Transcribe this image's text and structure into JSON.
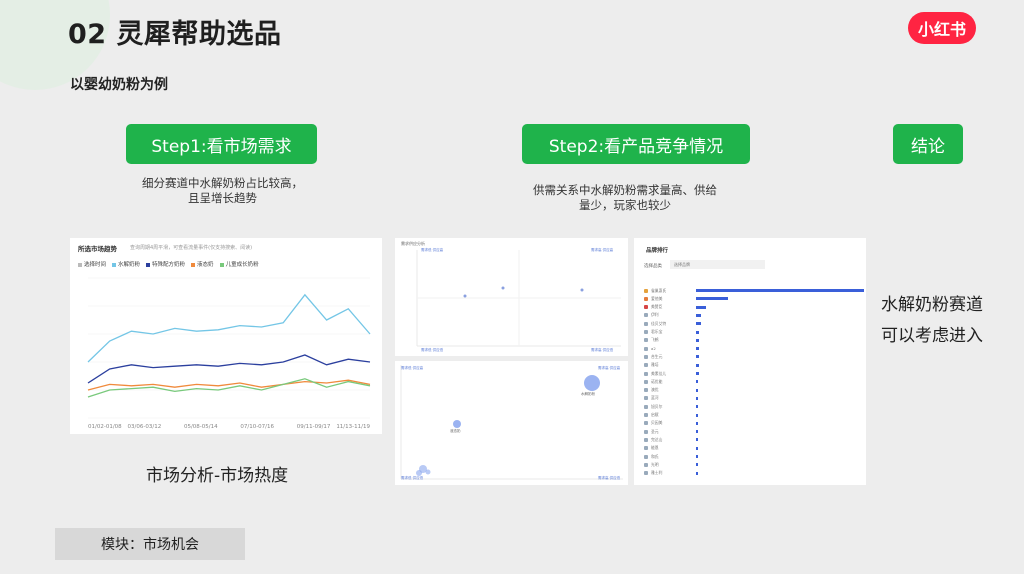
{
  "slide": {
    "title": "02 灵犀帮助选品",
    "logo": "小红书",
    "subtitle": "以婴幼奶粉为例",
    "caption": "市场分析-市场热度",
    "module_tag": "模块：市场机会"
  },
  "steps": [
    {
      "label": "Step1:看市场需求",
      "desc": "细分赛道中水解奶粉占比较高，且呈增长趋势"
    },
    {
      "label": "Step2:看产品竞争情况",
      "desc": "供需关系中水解奶粉需求量高、供给量少，玩家也较少"
    },
    {
      "label": "结论",
      "desc": "水解奶粉赛道可以考虑进入"
    }
  ],
  "chart_panel": {
    "title": "所选市场趋势",
    "note": "查询周期4周平滑，可查看流量事件(仅支持搜索、阅读)",
    "legend": [
      {
        "name": "选择时间",
        "color": "#bbbbbb"
      },
      {
        "name": "水解奶粉",
        "color": "#74c6e6"
      },
      {
        "name": "特殊配方奶粉",
        "color": "#2b3f9e"
      },
      {
        "name": "液态奶",
        "color": "#f08a3c"
      },
      {
        "name": "儿童成长奶粉",
        "color": "#79c97c"
      }
    ],
    "x_ticks": [
      "01/02-01/08",
      "03/06-03/12",
      "05/08-05/14",
      "07/10-07/16",
      "09/11-09/17",
      "11/13-11/19"
    ]
  },
  "chart_data": {
    "type": "line",
    "title": "所选市场趋势",
    "categories": [
      "01/02-01/08",
      "03/06-03/12",
      "05/08-05/14",
      "07/10-07/16",
      "09/11-09/17",
      "11/13-11/19"
    ],
    "series": [
      {
        "name": "水解奶粉",
        "values": [
          40,
          55,
          62,
          60,
          64,
          62,
          63,
          66,
          65,
          68,
          88,
          70,
          78,
          60
        ]
      },
      {
        "name": "特殊配方奶粉",
        "values": [
          25,
          35,
          38,
          36,
          37,
          38,
          37,
          39,
          38,
          40,
          45,
          38,
          42,
          40
        ]
      },
      {
        "name": "液态奶",
        "values": [
          20,
          24,
          23,
          24,
          22,
          24,
          23,
          25,
          22,
          24,
          26,
          25,
          27,
          24
        ]
      },
      {
        "name": "儿童成长奶粉",
        "values": [
          15,
          20,
          21,
          22,
          19,
          21,
          20,
          23,
          20,
          24,
          28,
          22,
          26,
          23
        ]
      }
    ],
    "grid": true
  },
  "supply_top": {
    "title": "需求供应分析",
    "quadrants": [
      "需求低 供应高",
      "需求高 供应高",
      "需求低 供应低",
      "需求高 供应低"
    ]
  },
  "supply_bottom": {
    "quadrants": [
      "需求低 供应高",
      "需求高 供应高",
      "需求低 供应低",
      "需求高 供应低"
    ],
    "bubble_labels": [
      "水解奶粉",
      "液态奶",
      "儿童成长奶粉"
    ]
  },
  "brand_panel": {
    "title": "品牌排行",
    "filter_label": "选择品类",
    "select_value": "选择品牌",
    "brands": [
      {
        "name": "雀巢惠氏",
        "value": 1.0,
        "color": "#e5a23c"
      },
      {
        "name": "爱他美",
        "value": 0.19,
        "color": "#e57c3c"
      },
      {
        "name": "美赞臣",
        "value": 0.06,
        "color": "#d64545"
      },
      {
        "name": "伊利",
        "value": 0.03,
        "color": "#9ab"
      },
      {
        "name": "佳贝艾特",
        "value": 0.03,
        "color": "#9ab"
      },
      {
        "name": "君乐宝",
        "value": 0.02,
        "color": "#9ab"
      },
      {
        "name": "飞鹤",
        "value": 0.02,
        "color": "#9ab"
      },
      {
        "name": "a2",
        "value": 0.02,
        "color": "#9ab"
      },
      {
        "name": "合生元",
        "value": 0.02,
        "color": "#9ab"
      },
      {
        "name": "雅培",
        "value": 0.02,
        "color": "#9ab"
      },
      {
        "name": "美素佳儿",
        "value": 0.02,
        "color": "#9ab"
      },
      {
        "name": "诺优能",
        "value": 0.01,
        "color": "#9ab"
      },
      {
        "name": "澳优",
        "value": 0.01,
        "color": "#9ab"
      },
      {
        "name": "蓝河",
        "value": 0.01,
        "color": "#9ab"
      },
      {
        "name": "旭贝尔",
        "value": 0.01,
        "color": "#9ab"
      },
      {
        "name": "启赋",
        "value": 0.01,
        "color": "#9ab"
      },
      {
        "name": "贝因美",
        "value": 0.01,
        "color": "#9ab"
      },
      {
        "name": "圣元",
        "value": 0.01,
        "color": "#9ab"
      },
      {
        "name": "完达山",
        "value": 0.01,
        "color": "#9ab"
      },
      {
        "name": "能恩",
        "value": 0.01,
        "color": "#9ab"
      },
      {
        "name": "和氏",
        "value": 0.01,
        "color": "#9ab"
      },
      {
        "name": "光明",
        "value": 0.01,
        "color": "#9ab"
      },
      {
        "name": "雅士利",
        "value": 0.01,
        "color": "#9ab"
      }
    ]
  },
  "conclusion_text": "水解奶粉赛道可以考虑进入"
}
